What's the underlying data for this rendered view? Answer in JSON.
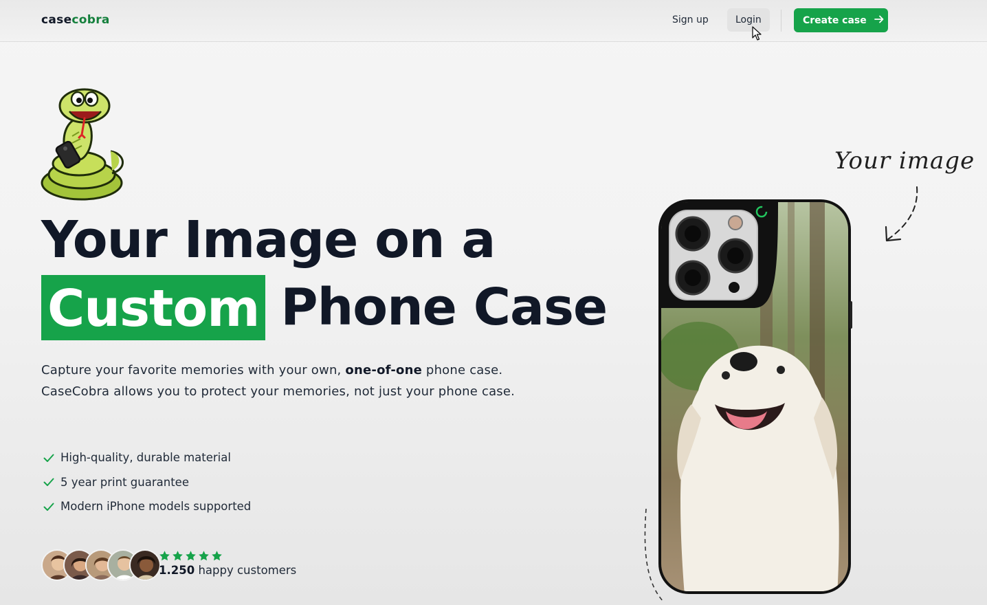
{
  "nav": {
    "logo_main": "case",
    "logo_accent": "cobra",
    "signup_label": "Sign up",
    "login_label": "Login",
    "create_label": "Create case",
    "create_icon": "arrow-right-icon"
  },
  "hero": {
    "headline_line1": "Your Image on a",
    "headline_highlight": "Custom",
    "headline_line2_rest": "Phone Case",
    "description_part1": "Capture your favorite memories with your own, ",
    "description_bold": "one-of-one",
    "description_part2": " phone case. CaseCobra allows you to protect your memories, not just your phone case.",
    "features": [
      "High-quality, durable material",
      "5 year print guarantee",
      "Modern iPhone models supported"
    ],
    "rating_stars": 5,
    "customers_count": "1.250",
    "customers_label": " happy customers"
  },
  "phone": {
    "handwriting_label": "Your image"
  },
  "colors": {
    "accent": "#16a34a",
    "text": "#111827",
    "background": "#f3f3f3"
  }
}
